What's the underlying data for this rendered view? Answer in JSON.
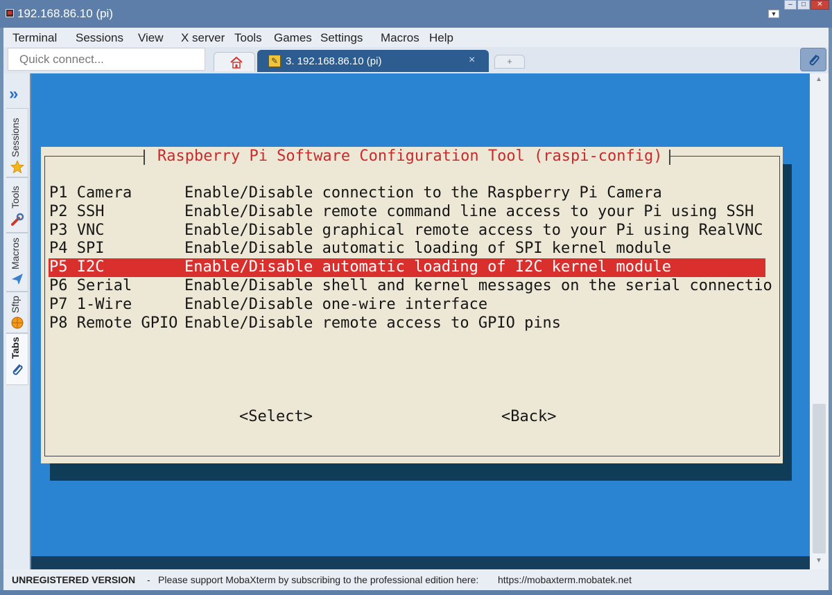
{
  "window": {
    "title": "192.168.86.10 (pi)"
  },
  "menubar": {
    "items": [
      "Terminal",
      "Sessions",
      "View",
      "X server",
      "Tools",
      "Games",
      "Settings",
      "Macros",
      "Help"
    ]
  },
  "toolbar": {
    "quick_connect_placeholder": "Quick connect...",
    "active_tab_label": "3. 192.168.86.10 (pi)",
    "close_glyph": "×",
    "new_tab_glyph": "+"
  },
  "sidebar": {
    "tabs": [
      {
        "label": "Sessions",
        "icon": "star-icon"
      },
      {
        "label": "Tools",
        "icon": "tools-icon"
      },
      {
        "label": "Macros",
        "icon": "macro-arrow-icon"
      },
      {
        "label": "Sftp",
        "icon": "sftp-globe-icon"
      },
      {
        "label": "Tabs",
        "icon": "paperclip-icon"
      }
    ]
  },
  "dialog": {
    "title": "Raspberry Pi Software Configuration Tool (raspi-config)",
    "options": [
      {
        "code": "P1 Camera",
        "desc": "Enable/Disable connection to the Raspberry Pi Camera"
      },
      {
        "code": "P2 SSH",
        "desc": "Enable/Disable remote command line access to your Pi using SSH"
      },
      {
        "code": "P3 VNC",
        "desc": "Enable/Disable graphical remote access to your Pi using RealVNC"
      },
      {
        "code": "P4 SPI",
        "desc": "Enable/Disable automatic loading of SPI kernel module"
      },
      {
        "code": "P5 I2C",
        "desc": "Enable/Disable automatic loading of I2C kernel module"
      },
      {
        "code": "P6 Serial",
        "desc": "Enable/Disable shell and kernel messages on the serial connectio"
      },
      {
        "code": "P7 1-Wire",
        "desc": "Enable/Disable one-wire interface"
      },
      {
        "code": "P8 Remote GPIO",
        "desc": "Enable/Disable remote access to GPIO pins"
      }
    ],
    "selected_index": 4,
    "select_button": "<Select>",
    "back_button": "<Back>"
  },
  "statusbar": {
    "version": "UNREGISTERED VERSION",
    "separator": "-",
    "message": "Please support MobaXterm by subscribing to the professional edition here:",
    "link": "https://mobaxterm.mobatek.net"
  },
  "colors": {
    "terminal_bg": "#2a84d2",
    "dialog_bg": "#ede7d6",
    "dialog_title": "#c92a2a",
    "selection": "#d9302e",
    "shadow": "#0f3c57"
  }
}
